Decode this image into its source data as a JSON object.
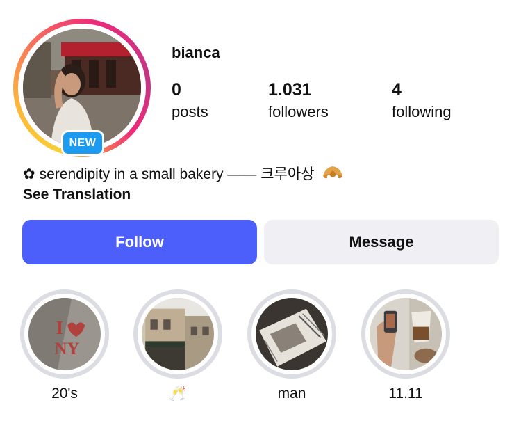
{
  "profile": {
    "username": "bianca",
    "badge": "NEW",
    "stats": [
      {
        "value": "0",
        "label": "posts"
      },
      {
        "value": "1.031",
        "label": "followers"
      },
      {
        "value": "4",
        "label": "following"
      }
    ],
    "bio_flower": "✿",
    "bio_text": "serendipity in a small bakery —— 크루아상",
    "see_translation": "See Translation"
  },
  "actions": {
    "follow_label": "Follow",
    "message_label": "Message"
  },
  "highlights": [
    {
      "caption": "20's"
    },
    {
      "caption": "🥂"
    },
    {
      "caption": "man"
    },
    {
      "caption": "11.11"
    }
  ],
  "colors": {
    "follow_button": "#4c5ffa",
    "message_button": "#efeff4",
    "badge": "#1d9bf0",
    "highlight_ring": "#dcdde2"
  }
}
